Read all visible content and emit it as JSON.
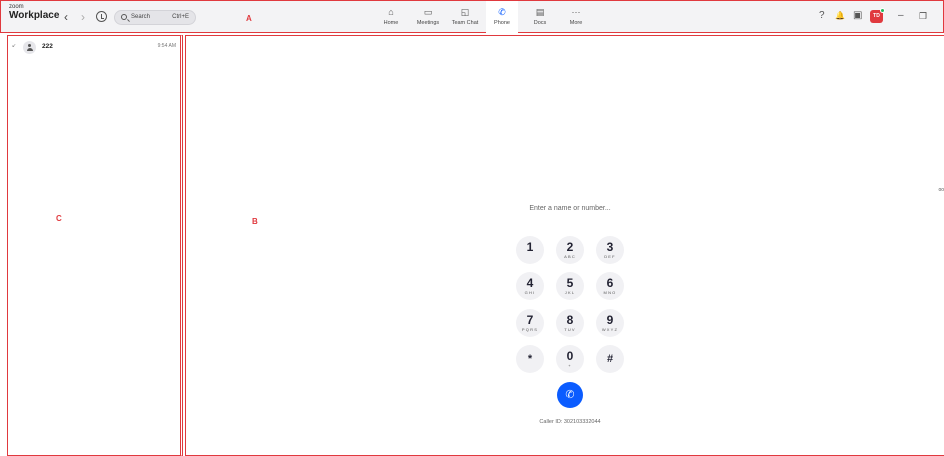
{
  "header": {
    "brand_small": "zoom",
    "brand": "Workplace",
    "back_icon": "‹",
    "forward_icon": "›",
    "search_label": "Search",
    "search_shortcut": "Ctrl+E",
    "tabs": [
      {
        "label": "Home",
        "icon": "⌂"
      },
      {
        "label": "Meetings",
        "icon": "▭"
      },
      {
        "label": "Team Chat",
        "icon": "◱"
      },
      {
        "label": "Phone",
        "icon": "✆"
      },
      {
        "label": "Docs",
        "icon": "▤"
      },
      {
        "label": "More",
        "icon": "···"
      }
    ],
    "avatar_initials": "TD",
    "minimize_icon": "–",
    "restore_icon": "❐",
    "help_icon": "?",
    "bell_icon": "🔔",
    "window_icon": "▣"
  },
  "annotations": {
    "a": "A",
    "b": "B",
    "c": "C"
  },
  "call_history": [
    {
      "direction_icon": "↙",
      "number": "222",
      "time": "9:54 AM"
    }
  ],
  "voicemail_label": "oo",
  "dialpad": {
    "placeholder": "Enter a name or number...",
    "keys": [
      {
        "digit": "1",
        "letters": ""
      },
      {
        "digit": "2",
        "letters": "ABC"
      },
      {
        "digit": "3",
        "letters": "DEF"
      },
      {
        "digit": "4",
        "letters": "GHI"
      },
      {
        "digit": "5",
        "letters": "JKL"
      },
      {
        "digit": "6",
        "letters": "MNO"
      },
      {
        "digit": "7",
        "letters": "PQRS"
      },
      {
        "digit": "8",
        "letters": "TUV"
      },
      {
        "digit": "9",
        "letters": "WXYZ"
      },
      {
        "digit": "*",
        "letters": ""
      },
      {
        "digit": "0",
        "letters": "+"
      },
      {
        "digit": "#",
        "letters": ""
      }
    ],
    "call_icon": "✆",
    "caller_id": "Caller ID: 302103332044"
  },
  "colors": {
    "accent": "#0b5cff",
    "annotation": "#e0393e"
  }
}
